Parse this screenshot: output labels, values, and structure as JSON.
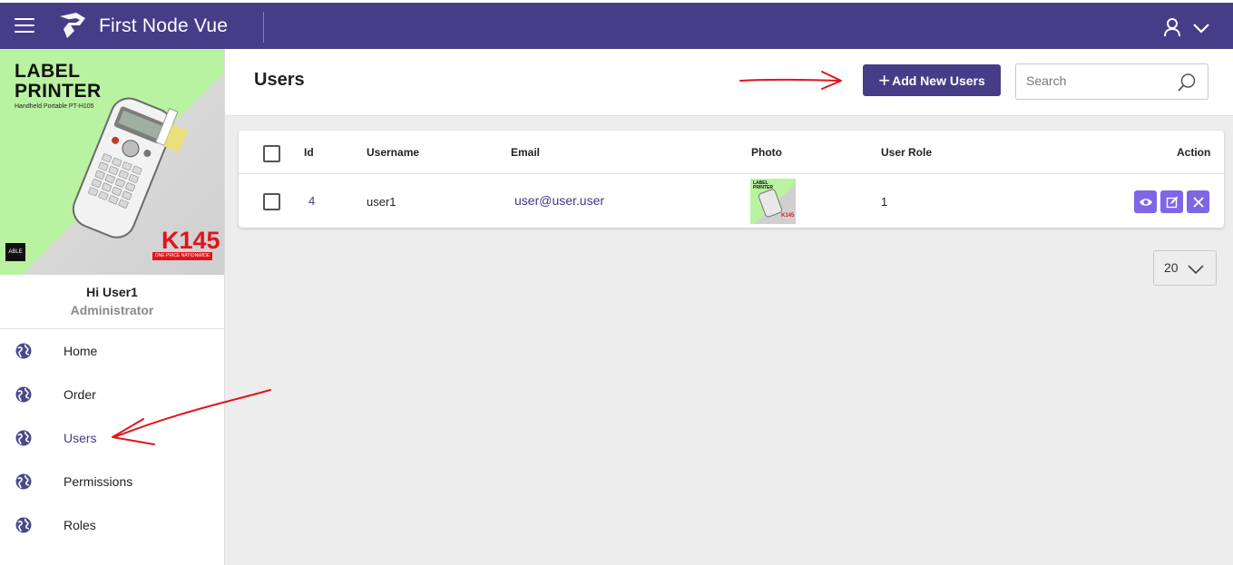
{
  "app": {
    "title": "First Node Vue"
  },
  "banner": {
    "title_line1": "LABEL",
    "title_line2": "PRINTER",
    "subtitle": "Handheld Portable PT-H105",
    "price": "K145",
    "price_tag": "ONE PRICE NATIONWIDE",
    "brand": "ABLE"
  },
  "profile": {
    "greeting": "Hi User1",
    "role": "Administrator"
  },
  "sidebar": {
    "items": [
      {
        "label": "Home",
        "icon": "globe-icon",
        "active": false
      },
      {
        "label": "Order",
        "icon": "globe-icon",
        "active": false
      },
      {
        "label": "Users",
        "icon": "globe-icon",
        "active": true
      },
      {
        "label": "Permissions",
        "icon": "globe-icon",
        "active": false
      },
      {
        "label": "Roles",
        "icon": "globe-icon",
        "active": false
      }
    ]
  },
  "page": {
    "title": "Users",
    "add_button": "Add New Users",
    "search_placeholder": "Search"
  },
  "table": {
    "columns": [
      "Id",
      "Username",
      "Email",
      "Photo",
      "User Role",
      "Action"
    ],
    "rows": [
      {
        "id": "4",
        "username": "user1",
        "email": "user@user.user",
        "photo": "label-printer-thumbnail",
        "user_role": "1"
      }
    ],
    "actions": [
      "view-icon",
      "edit-icon",
      "delete-icon"
    ]
  },
  "pagination": {
    "page_size": "20"
  },
  "colors": {
    "primary": "#473c87",
    "action": "#7f66e6",
    "annotation": "#e0141d",
    "background": "#ededed"
  }
}
